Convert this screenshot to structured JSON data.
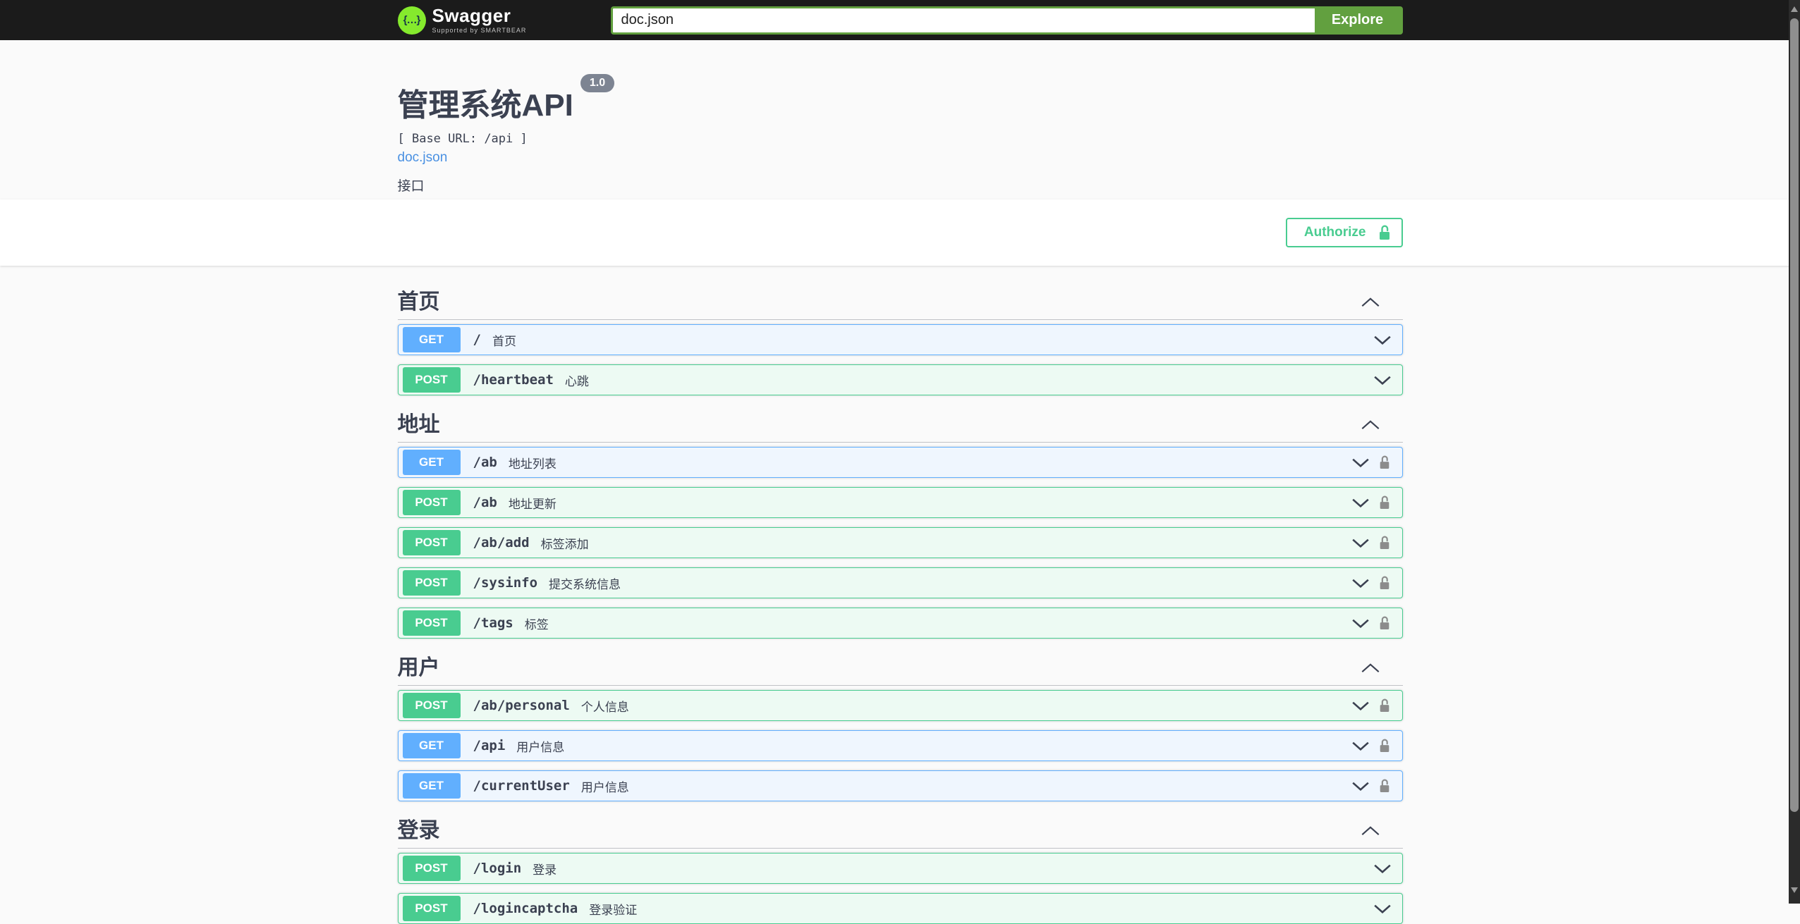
{
  "topbar": {
    "brand": "Swagger",
    "brand_sub": "Supported by  SMARTBEAR",
    "logo_glyph": "{…}",
    "search_value": "doc.json",
    "explore_label": "Explore"
  },
  "info": {
    "title": "管理系统API",
    "version": "1.0",
    "base_url": "[ Base URL: /api ]",
    "spec_link": "doc.json",
    "description": "接口"
  },
  "auth": {
    "authorize_label": "Authorize"
  },
  "sections": [
    {
      "name": "首页",
      "operations": [
        {
          "method": "GET",
          "path": "/",
          "summary": "首页",
          "locked": false
        },
        {
          "method": "POST",
          "path": "/heartbeat",
          "summary": "心跳",
          "locked": false
        }
      ]
    },
    {
      "name": "地址",
      "operations": [
        {
          "method": "GET",
          "path": "/ab",
          "summary": "地址列表",
          "locked": true
        },
        {
          "method": "POST",
          "path": "/ab",
          "summary": "地址更新",
          "locked": true
        },
        {
          "method": "POST",
          "path": "/ab/add",
          "summary": "标签添加",
          "locked": true
        },
        {
          "method": "POST",
          "path": "/sysinfo",
          "summary": "提交系统信息",
          "locked": true
        },
        {
          "method": "POST",
          "path": "/tags",
          "summary": "标签",
          "locked": true
        }
      ]
    },
    {
      "name": "用户",
      "operations": [
        {
          "method": "POST",
          "path": "/ab/personal",
          "summary": "个人信息",
          "locked": true
        },
        {
          "method": "GET",
          "path": "/api",
          "summary": "用户信息",
          "locked": true
        },
        {
          "method": "GET",
          "path": "/currentUser",
          "summary": "用户信息",
          "locked": true
        }
      ]
    },
    {
      "name": "登录",
      "operations": [
        {
          "method": "POST",
          "path": "/login",
          "summary": "登录",
          "locked": false
        },
        {
          "method": "POST",
          "path": "/logincaptcha",
          "summary": "登录验证",
          "locked": false
        }
      ]
    }
  ],
  "icons": {
    "swagger_logo": "green circle with braces",
    "authorize_lock": "unlocked padlock (green)",
    "row_lock": "unlocked padlock (gray)",
    "expand": "chevron-down",
    "collapse": "chevron-up",
    "scroll_up": "triangle-up",
    "scroll_down": "triangle-down"
  },
  "colors": {
    "topbar_bg": "#1b1b1b",
    "explore_green": "#62a03f",
    "logo_green": "#85ea2d",
    "get_blue": "#61affe",
    "post_green": "#49cc90",
    "link_blue": "#4990e2",
    "version_badge_gray": "#7d8492",
    "text_dark": "#3b4151",
    "lock_gray": "#8c8c8c",
    "hero_bg": "#fafafa"
  }
}
